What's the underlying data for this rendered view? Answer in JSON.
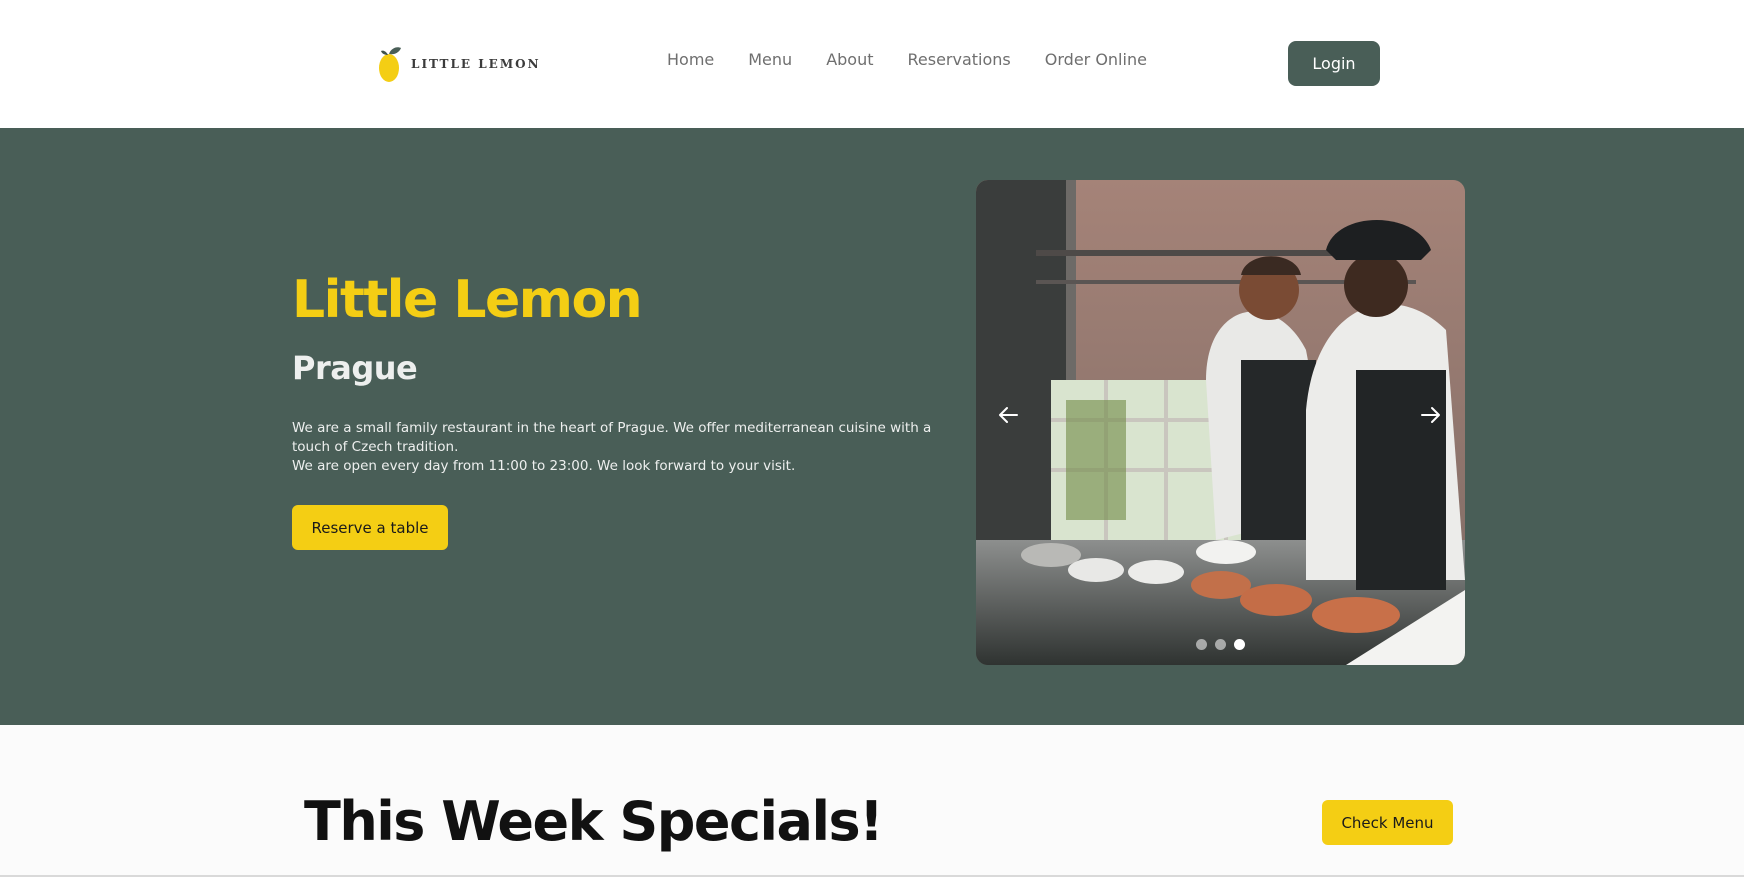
{
  "header": {
    "logo_text": "LITTLE LEMON",
    "nav": [
      {
        "label": "Home"
      },
      {
        "label": "Menu"
      },
      {
        "label": "About"
      },
      {
        "label": "Reservations"
      },
      {
        "label": "Order Online"
      }
    ],
    "login_label": "Login"
  },
  "hero": {
    "title": "Little Lemon",
    "subtitle": "Prague",
    "description_line1": "We are a small family restaurant in the heart of Prague. We offer mediterranean cuisine with a touch of Czech tradition.",
    "description_line2": "We are open every day from 11:00 to 23:00. We look forward to your visit.",
    "reserve_label": "Reserve a table",
    "carousel": {
      "prev_icon": "arrow-left-icon",
      "next_icon": "arrow-right-icon",
      "slide_count": 3,
      "active_slide": 3
    }
  },
  "specials": {
    "title": "This Week Specials!",
    "check_menu_label": "Check Menu"
  },
  "colors": {
    "primary_green": "#495e57",
    "primary_yellow": "#f4ce14",
    "highlight_light": "#edefee"
  }
}
